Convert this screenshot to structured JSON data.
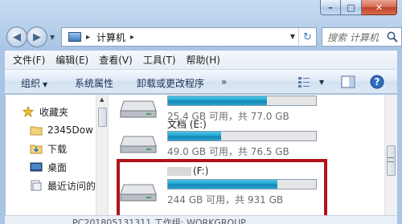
{
  "window": {
    "caption_min": "–",
    "caption_max": "□",
    "caption_close": "✕"
  },
  "nav": {
    "back_glyph": "◀",
    "forward_glyph": "▶"
  },
  "address": {
    "separator": "▸",
    "crumb": "计算机",
    "crumb_sep": "▸",
    "refresh_glyph": "↻"
  },
  "search": {
    "placeholder": "搜索 计算机"
  },
  "menu": {
    "items": [
      "文件(F)",
      "编辑(E)",
      "查看(V)",
      "工具(T)",
      "帮助(H)"
    ]
  },
  "toolbar": {
    "organize": "组织",
    "system_properties": "系统属性",
    "uninstall": "卸载或更改程序",
    "more": "»",
    "help_glyph": "?"
  },
  "navpane": {
    "items": [
      "收藏夹",
      "2345Dow",
      "下载",
      "桌面",
      "最近访问的"
    ]
  },
  "drives": [
    {
      "name": "",
      "free": "25.4 GB 可用，共 77.0 GB",
      "used_fraction": 0.67
    },
    {
      "name": "文档 (E:)",
      "free": "49.0 GB 可用，共 76.5 GB",
      "used_fraction": 0.36
    },
    {
      "name": "(F:)",
      "free": "244 GB 可用，共 931 GB",
      "used_fraction": 0.74
    }
  ],
  "statusbar": {
    "text": "PC201805131311  工作组: WORKGROUP"
  },
  "colors": {
    "highlight_border": "#b0131a",
    "bar_fill": "#1ea0cc"
  }
}
